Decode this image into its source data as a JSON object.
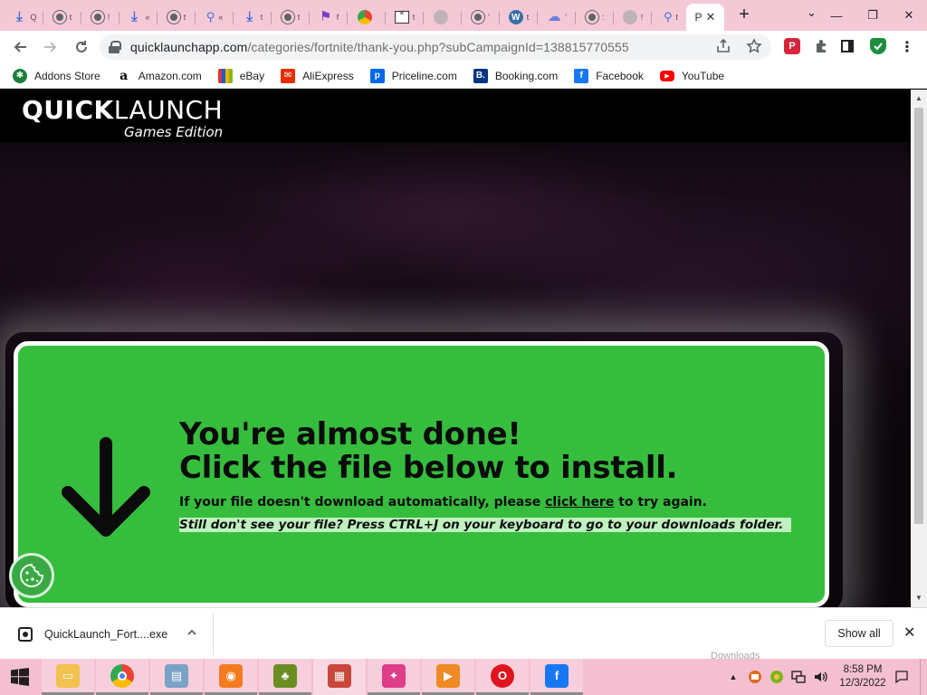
{
  "browser": {
    "tabs": [
      {
        "icon": "download-icon",
        "label": "Q"
      },
      {
        "icon": "globe-icon",
        "label": "t"
      },
      {
        "icon": "globe-icon",
        "label": "!"
      },
      {
        "icon": "download-icon",
        "label": "«"
      },
      {
        "icon": "globe-icon",
        "label": "t"
      },
      {
        "icon": "search-icon",
        "label": "«"
      },
      {
        "icon": "download-icon",
        "label": "t"
      },
      {
        "icon": "globe-icon",
        "label": "t"
      },
      {
        "icon": "flag-icon",
        "label": "f"
      },
      {
        "icon": "chrome-icon",
        "label": ""
      },
      {
        "icon": "text-icon",
        "label": "t"
      },
      {
        "icon": "grey-globe-icon",
        "label": ""
      },
      {
        "icon": "globe-icon",
        "label": "'"
      },
      {
        "icon": "wordpress-icon",
        "label": "t"
      },
      {
        "icon": "cloud-icon",
        "label": "'"
      },
      {
        "icon": "globe-icon",
        "label": ":"
      },
      {
        "icon": "grey-globe-icon",
        "label": "!"
      },
      {
        "icon": "search-icon",
        "label": "t"
      }
    ],
    "active_tab": {
      "letter": "P",
      "close": "✕"
    },
    "new_tab": "+",
    "window": {
      "dropdown": "⌄",
      "minimize": "—",
      "restore": "❐",
      "close": "✕"
    },
    "address": {
      "host": "quicklaunchapp.com",
      "path": "/categories/fortnite/thank-you.php?subCampaignId=138815770555"
    },
    "extensions": {
      "pocket": "P"
    },
    "bookmarks": [
      {
        "label": "Addons Store",
        "icon": "addons-icon",
        "glyph": "✱"
      },
      {
        "label": "Amazon.com",
        "icon": "amazon-icon",
        "glyph": "a"
      },
      {
        "label": "eBay",
        "icon": "ebay-icon",
        "glyph": ""
      },
      {
        "label": "AliExpress",
        "icon": "aliexpress-icon",
        "glyph": "✉"
      },
      {
        "label": "Priceline.com",
        "icon": "priceline-icon",
        "glyph": "p"
      },
      {
        "label": "Booking.com",
        "icon": "booking-icon",
        "glyph": "B."
      },
      {
        "label": "Facebook",
        "icon": "facebook-icon",
        "glyph": "f"
      },
      {
        "label": "YouTube",
        "icon": "youtube-icon",
        "glyph": "▶"
      }
    ]
  },
  "page": {
    "logo": {
      "bold": "QUICK",
      "light": "LAUNCH",
      "sub": "Games Edition"
    },
    "card": {
      "title_line1": "You're almost done!",
      "title_line2": "Click the file below to install.",
      "line_before": "If your file doesn't download automatically, please ",
      "link": "click here",
      "line_after": " to try again.",
      "hint": "Still don't see your file? Press CTRL+J on your keyboard to go to your downloads folder."
    },
    "colors": {
      "card_green": "#36bd3d",
      "hint_green": "#bff0bf"
    }
  },
  "download_bar": {
    "filename": "QuickLaunch_Fort....exe",
    "show_all": "Show all",
    "close": "✕"
  },
  "taskbar": {
    "ghost_label": "Downloads",
    "apps": [
      {
        "name": "file-explorer-icon",
        "color": "#f2c14e",
        "glyph": "▭",
        "state": "open"
      },
      {
        "name": "chrome-icon",
        "color": "chrome",
        "glyph": "",
        "state": "open"
      },
      {
        "name": "monitor-app-icon",
        "color": "#7aa1c6",
        "glyph": "▤",
        "state": "open"
      },
      {
        "name": "avast-icon",
        "color": "#f47b20",
        "glyph": "◉",
        "state": "open"
      },
      {
        "name": "game-app-icon",
        "color": "#6b8e23",
        "glyph": "♣",
        "state": "open"
      },
      {
        "name": "winrar-icon",
        "color": "#c8463a",
        "glyph": "▦",
        "state": "active"
      },
      {
        "name": "media-app-icon",
        "color": "#e03c8a",
        "glyph": "✦",
        "state": "open"
      },
      {
        "name": "video-player-icon",
        "color": "#f08a24",
        "glyph": "▶",
        "state": "open"
      },
      {
        "name": "opera-icon",
        "color": "#e1131e",
        "glyph": "O",
        "state": "open"
      },
      {
        "name": "facebook-icon",
        "color": "#1877f2",
        "glyph": "f",
        "state": "open"
      }
    ],
    "tray": {
      "expand": "▲",
      "time": "8:58 PM",
      "date": "12/3/2022"
    }
  }
}
